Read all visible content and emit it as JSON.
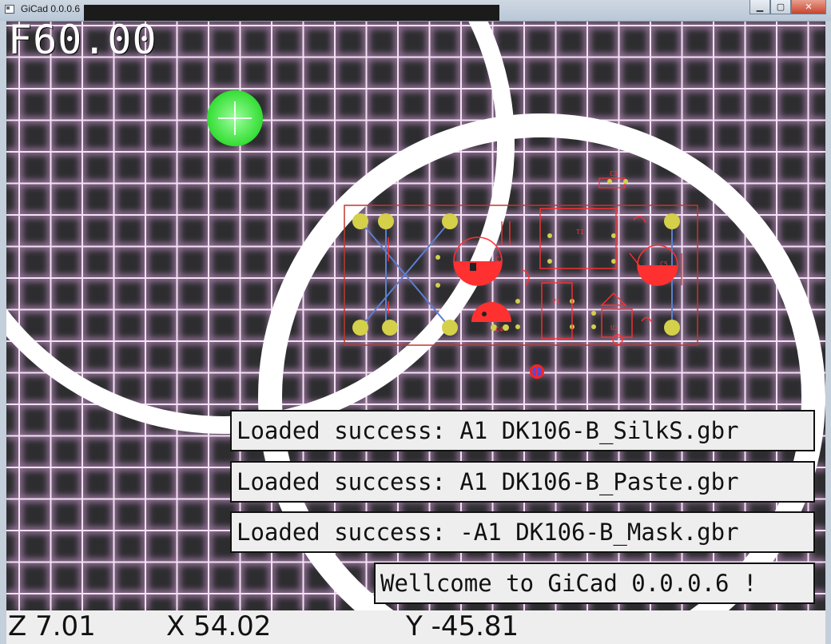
{
  "window": {
    "title": "GiCad 0.0.0.6",
    "controls": {
      "minimize": "▁",
      "maximize": "▢",
      "close": "✕"
    }
  },
  "overlay": {
    "frequency": "F60.00"
  },
  "messages": [
    {
      "text": "Loaded success: A1 DK106-B_SilkS.gbr"
    },
    {
      "text": "Loaded success: A1 DK106-B_Paste.gbr"
    },
    {
      "text": "Loaded success: -A1 DK106-B_Mask.gbr"
    },
    {
      "text": "Wellcome to GiCad 0.0.0.6 !"
    }
  ],
  "status": {
    "z": "Z 7.01",
    "x": "X 54.02",
    "y": "Y -45.81"
  },
  "pcb_labels": {
    "c1": "C1",
    "c4": "C4",
    "v1": "V1",
    "u2": "U2",
    "c3": "C3",
    "t1": "T1",
    "c5": "C5"
  },
  "colors": {
    "grid_line": "#e2a6e6",
    "grid_core": "#fff0ff",
    "background": "#2d2d30",
    "pcb_outline": "#c0392b",
    "pcb_red": "#ff3030",
    "pad_yellow": "#d4d04a",
    "trace_blue": "#5b7fcf",
    "cursor_green": "#44ee44",
    "ring_white": "#ffffff"
  }
}
